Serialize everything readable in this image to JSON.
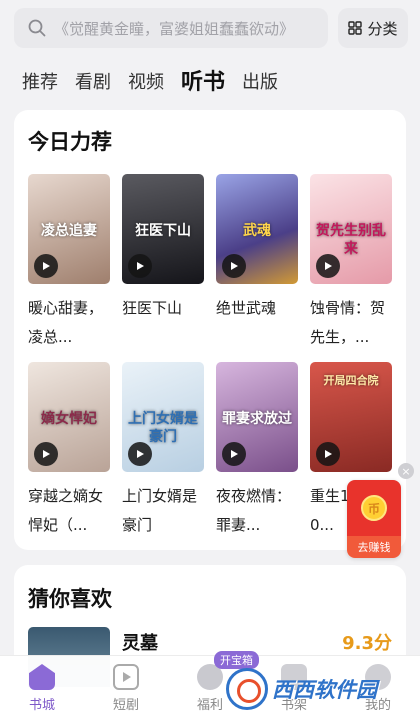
{
  "search": {
    "placeholder": "《觉醒黄金瞳，富婆姐姐蠢蠢欲动》"
  },
  "category_button": {
    "label": "分类"
  },
  "tabs": [
    {
      "label": "推荐"
    },
    {
      "label": "看剧"
    },
    {
      "label": "视频"
    },
    {
      "label": "听书"
    },
    {
      "label": "出版"
    }
  ],
  "today": {
    "title": "今日力荐",
    "books": [
      {
        "title": "暖心甜妻，凌总...",
        "cover_text": "凌总追妻",
        "cover_color": "#c9b6a7"
      },
      {
        "title": "狂医下山",
        "cover_text": "狂医下山",
        "cover_color": "#2a2a2e"
      },
      {
        "title": "绝世武魂",
        "cover_text": "武魂",
        "cover_color": "#6c6ab3"
      },
      {
        "title": "蚀骨情：贺先生，...",
        "cover_text": "贺先生别乱来",
        "cover_color": "#f0c4c9"
      },
      {
        "title": "穿越之嫡女悍妃（...",
        "cover_text": "嫡女悍妃",
        "cover_color": "#d9cdc4"
      },
      {
        "title": "上门女婿是豪门",
        "cover_text": "上门女婿是豪门",
        "cover_color": "#cfe0ee"
      },
      {
        "title": "夜夜燃情：罪妻...",
        "cover_text": "罪妻求放过",
        "cover_color": "#b58bc1"
      },
      {
        "title": "重生1980...",
        "cover_text": "开局四合院",
        "cover_color": "#b8423a"
      }
    ]
  },
  "float_packet": {
    "label": "去赚钱",
    "coin": "币"
  },
  "guess": {
    "title": "猜你喜欢",
    "item": {
      "title": "灵墓",
      "score": "9.3分"
    }
  },
  "bottom_nav": [
    {
      "label": "书城"
    },
    {
      "label": "短剧"
    },
    {
      "label": "福利"
    },
    {
      "label": "书架"
    },
    {
      "label": "我的"
    }
  ],
  "welfare_badge": "开宝箱",
  "watermark": "西西软件园",
  "colors": {
    "accent": "#7e58c9",
    "score": "#e79a1a",
    "packet": "#e8332c"
  }
}
